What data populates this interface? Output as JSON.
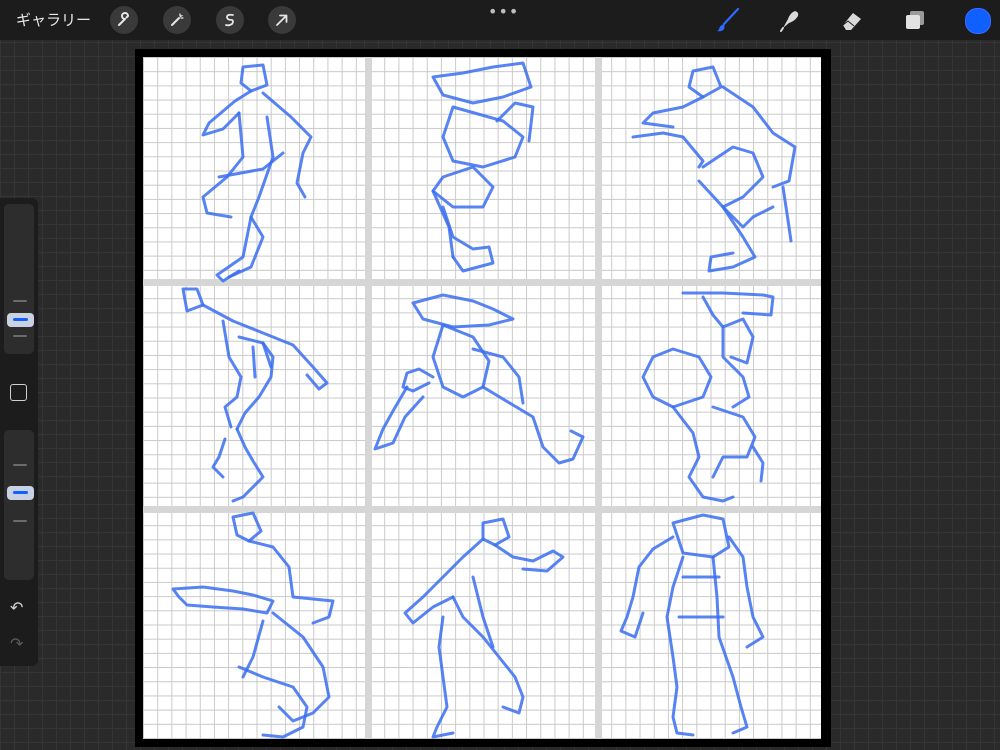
{
  "topbar": {
    "gallery_label": "ギャラリー",
    "more_glyph": "•••",
    "tools_left": [
      "wrench-icon",
      "magic-wand-icon",
      "selection-icon",
      "transform-arrow-icon"
    ],
    "tools_right": [
      "brush-icon",
      "smudge-icon",
      "eraser-icon",
      "layers-icon"
    ],
    "active_tool": "brush-icon",
    "current_color": "#1060ff"
  },
  "sidebar": {
    "controls": [
      "brush-size-slider",
      "modify-button",
      "opacity-slider",
      "undo-icon",
      "redo-icon"
    ]
  },
  "canvas": {
    "background": "#ffffff",
    "grid_color": "#c9c9c9",
    "stroke_color": "#3a6ff0",
    "panel_rows": 3,
    "panel_cols": 3
  }
}
